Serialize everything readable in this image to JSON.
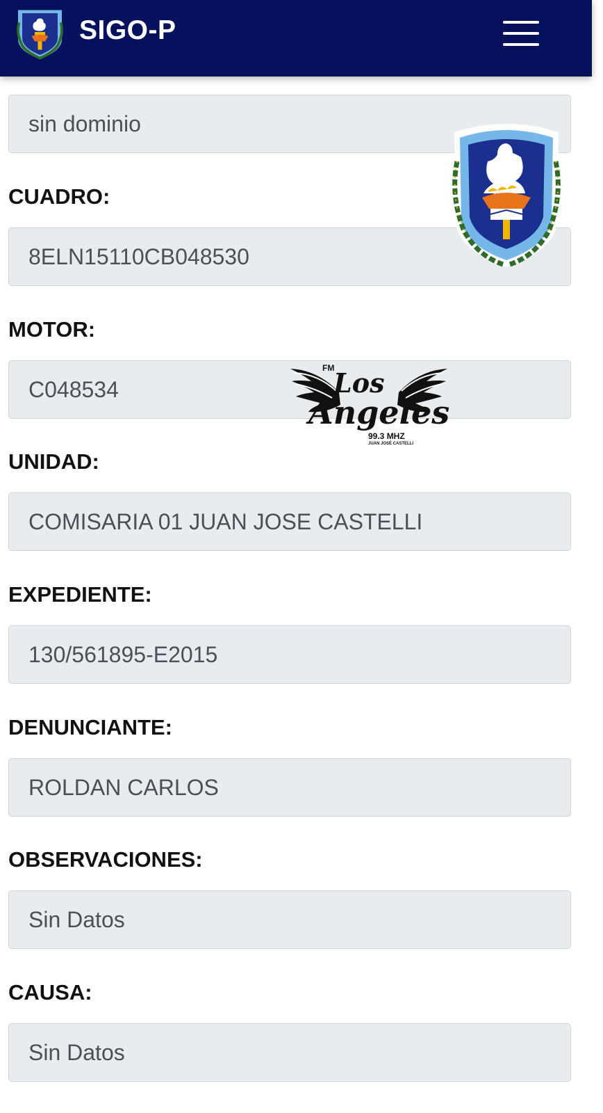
{
  "app": {
    "title": "SIGO-P"
  },
  "navbar": {
    "menu_icon": "hamburger-menu-icon",
    "background": "#06115e"
  },
  "fields": [
    {
      "label": "",
      "value": "sin dominio"
    },
    {
      "label": "CUADRO:",
      "value": "8ELN15110CB048530"
    },
    {
      "label": "MOTOR:",
      "value": "C048534"
    },
    {
      "label": "UNIDAD:",
      "value": "COMISARIA 01 JUAN JOSE CASTELLI"
    },
    {
      "label": "EXPEDIENTE:",
      "value": "130/561895-E2015"
    },
    {
      "label": "DENUNCIANTE:",
      "value": "ROLDAN CARLOS"
    },
    {
      "label": "OBSERVACIONES:",
      "value": "Sin Datos"
    },
    {
      "label": "CAUSA:",
      "value": "Sin Datos"
    }
  ],
  "watermarks": {
    "police_shield": "police-shield-logo",
    "radio": {
      "prefix": "FM",
      "name_line1": "Los",
      "name_line2": "Angeles",
      "frequency": "99.3 MHZ",
      "town": "JUAN JOSÉ CASTELLI"
    }
  },
  "colors": {
    "navbar": "#06115e",
    "input_background": "#e9ecef",
    "input_border": "#ced4da",
    "input_text": "#495057",
    "shield_blue": "#1b2f8f",
    "flag_light_blue": "#74b7e8",
    "laurel_green": "#2f6b2b"
  }
}
